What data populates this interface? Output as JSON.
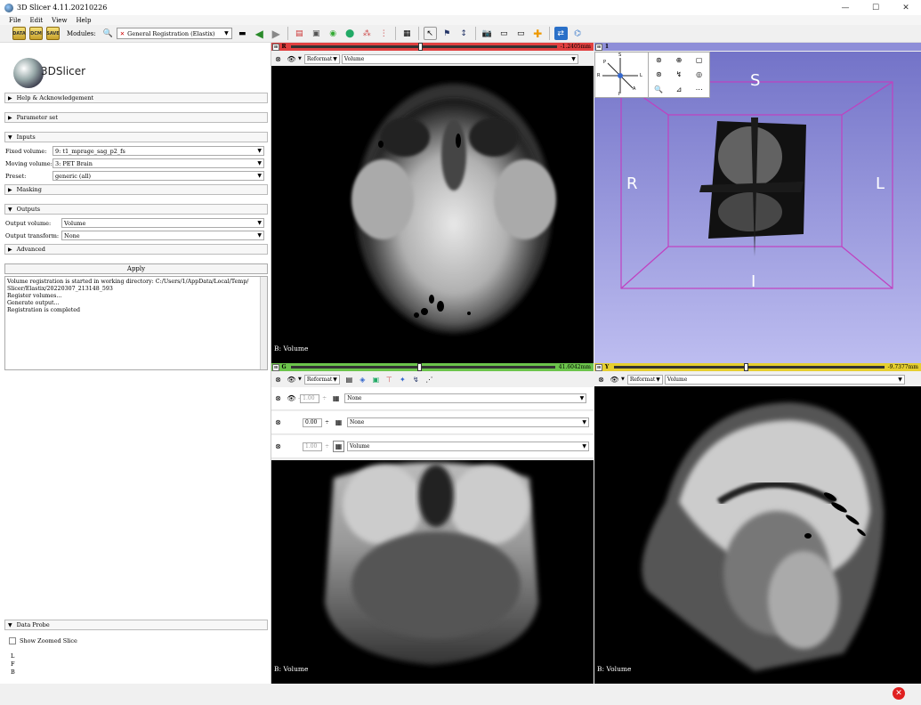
{
  "window": {
    "title": "3D Slicer 4.11.20210226",
    "minimize": "—",
    "maximize": "☐",
    "close": "✕"
  },
  "menu": {
    "file": "File",
    "edit": "Edit",
    "view": "View",
    "help": "Help"
  },
  "toolbar": {
    "modules_label": "Modules:",
    "module_selected": "General Registration (Elastix)",
    "data_label": "DATA",
    "dcm_label": "DCM",
    "save_label": "SAVE"
  },
  "logo_text": "3DSlicer",
  "sections": {
    "help": "Help & Acknowledgement",
    "parameter_set": "Parameter set",
    "inputs": "Inputs",
    "masking": "Masking",
    "outputs": "Outputs",
    "advanced": "Advanced",
    "data_probe": "Data Probe"
  },
  "inputs": {
    "fixed_label": "Fixed volume:",
    "fixed_value": "9: t1_mprage_sag_p2_fs",
    "moving_label": "Moving volume:",
    "moving_value": "3: PET Brain",
    "preset_label": "Preset:",
    "preset_value": "generic (all)"
  },
  "outputs": {
    "volume_label": "Output volume:",
    "volume_value": "Volume",
    "transform_label": "Output transform:",
    "transform_value": "None"
  },
  "apply_label": "Apply",
  "log_lines": [
    "Volume registration is started in working directory: C:/Users/1/AppData/Local/Temp/",
    "Slicer/Elastix/20220307_213148_593",
    "Register volumes...",
    "Generate output...",
    "Registration is completed"
  ],
  "data_probe": {
    "show_zoomed": "Show Zoomed Slice",
    "l": "L",
    "f": "F",
    "b": "B"
  },
  "views": {
    "red": {
      "letter": "R",
      "offset": "-1.2405mm",
      "reformat": "Reformat",
      "volume": "Volume",
      "label": "B: Volume",
      "slider": 0.48
    },
    "green": {
      "letter": "G",
      "offset": "41.6042mm",
      "reformat": "Reformat",
      "volume": "Volume",
      "label": "B: Volume",
      "slider": 0.48
    },
    "yellow": {
      "letter": "Y",
      "offset": "-9.7377mm",
      "reformat": "Reformat",
      "volume": "Volume",
      "label": "B: Volume",
      "slider": 0.48
    },
    "threed": {
      "number": "1",
      "s": "S",
      "i": "I",
      "r": "R",
      "l": "L"
    }
  },
  "layers": {
    "label_value": "1.00",
    "label_layer": "None",
    "fg_value": "0.00",
    "fg_layer": "None",
    "bg_value": "1.00",
    "bg_layer": "Volume"
  },
  "orientation_cube": {
    "s": "S",
    "p": "P",
    "r": "R",
    "l": "L",
    "a": "A",
    "i": "I"
  },
  "colors": {
    "red": "#e04040",
    "green": "#6bc44b",
    "yellow": "#e6cf2f",
    "threed_bg": "#8e8ed8",
    "threed_box": "#c040c0"
  }
}
